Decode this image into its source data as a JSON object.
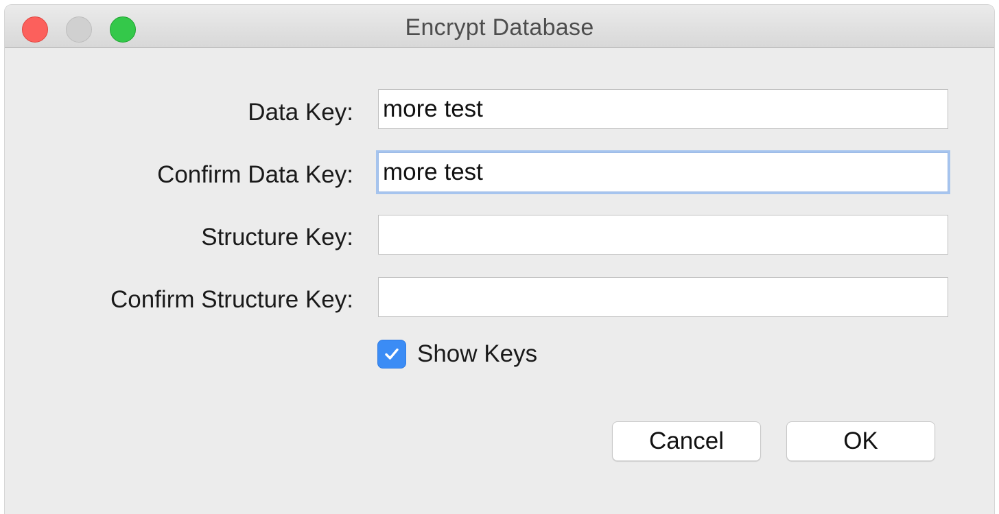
{
  "window": {
    "title": "Encrypt Database"
  },
  "form": {
    "data_key": {
      "label": "Data Key:",
      "value": "more test"
    },
    "confirm_data_key": {
      "label": "Confirm Data Key:",
      "value": "more test"
    },
    "structure_key": {
      "label": "Structure Key:",
      "value": ""
    },
    "confirm_structure_key": {
      "label": "Confirm Structure Key:",
      "value": ""
    },
    "show_keys": {
      "label": "Show Keys",
      "checked": true
    }
  },
  "buttons": {
    "cancel_label": "Cancel",
    "ok_label": "OK"
  },
  "colors": {
    "accent": "#3b8cf5",
    "focus_ring": "#a6c4ee",
    "close": "#fc605c",
    "zoom": "#34c84a"
  },
  "icons": {
    "checkbox": "checkmark-icon"
  }
}
